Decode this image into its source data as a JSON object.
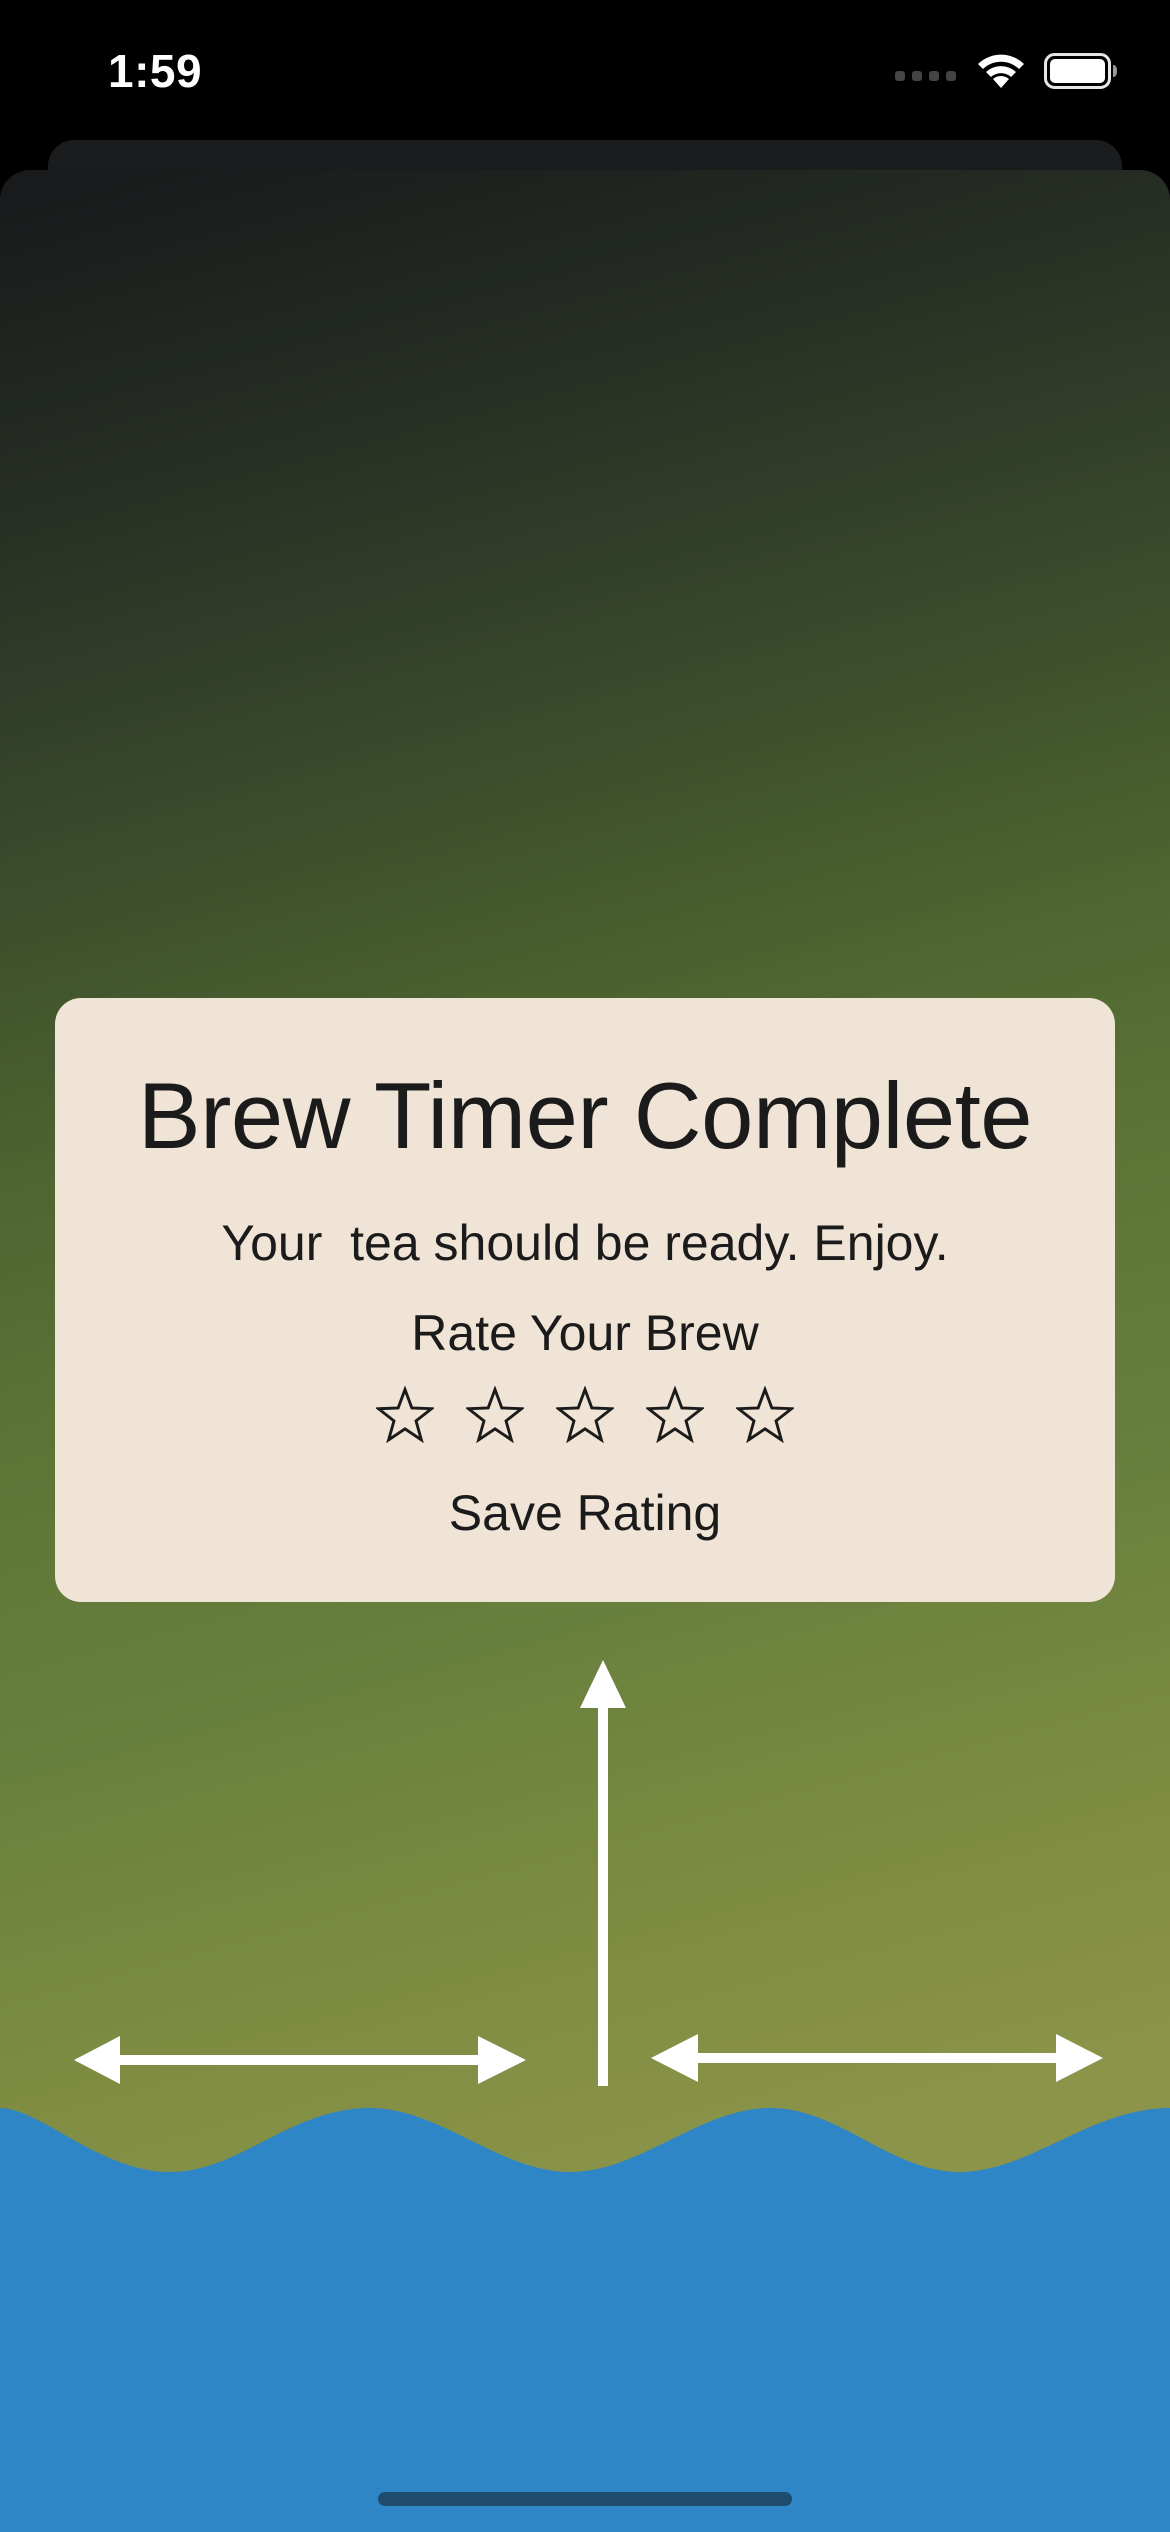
{
  "status_bar": {
    "time": "1:59"
  },
  "dialog": {
    "title": "Brew Timer Complete",
    "message": "Your  tea should be ready. Enjoy.",
    "rate_label": "Rate Your Brew",
    "star_count": 5,
    "rating": 0,
    "save_label": "Save Rating"
  },
  "colors": {
    "dialog_bg": "#f0e4d6",
    "water": "#2f86c6",
    "arrow": "#ffffff"
  }
}
